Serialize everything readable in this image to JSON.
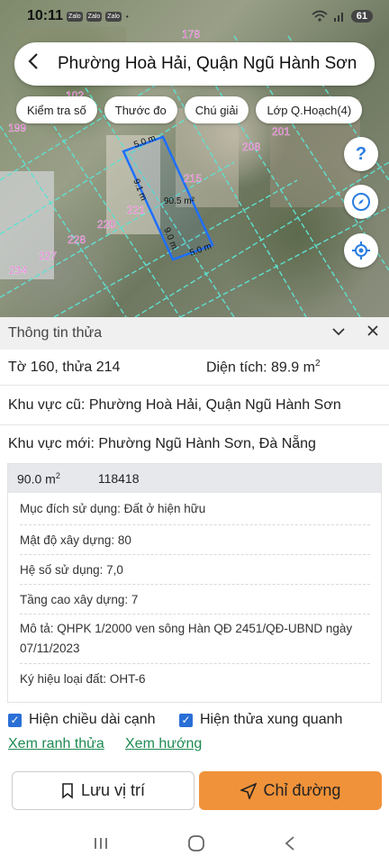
{
  "status_bar": {
    "time": "10:11",
    "apps": [
      "Zalo",
      "Zalo",
      "Zalo"
    ],
    "dot": "•",
    "wifi": "wifi-icon",
    "signal": "signal-icon",
    "battery": "61"
  },
  "header": {
    "title": "Phường Hoà Hải, Quận Ngũ Hành Sơn"
  },
  "chips": [
    "Kiểm tra số",
    "Thước đo",
    "Chú giải",
    "Lớp Q.Hoạch(4)"
  ],
  "map": {
    "parcel_labels": [
      "178",
      "102",
      "199",
      "208",
      "201",
      "215",
      "221",
      "220",
      "228",
      "227",
      "234"
    ],
    "dimension_labels": [
      "5.0 m",
      "9.1 m",
      "90.5 m²",
      "9.0 m",
      "5.0 m"
    ],
    "side_buttons": [
      "help-icon",
      "compass-icon",
      "locate-icon"
    ]
  },
  "panel": {
    "title": "Thông tin thửa",
    "sheet_parcel": "Tờ 160, thửa 214",
    "area_label": "Diện tích: 89.9 m",
    "area_sup": "2",
    "old_area": "Khu vực cũ: Phường Hoà Hải, Quận Ngũ Hành Sơn",
    "new_area": "Khu vực mới: Phường Ngũ Hành Sơn, Đà Nẵng"
  },
  "table": {
    "area": "90.0 m",
    "area_sup": "2",
    "code": "118418",
    "items": [
      "Mục đích sử dụng: Đất ở hiện hữu",
      "Mật độ xây dựng: 80",
      "Hệ số sử dụng: 7,0",
      "Tầng cao xây dựng: 7",
      "Mô tả: QHPK 1/2000 ven sông Hàn QĐ 2451/QĐ-UBND ngày 07/11/2023",
      "Ký hiệu loại đất: OHT-6"
    ]
  },
  "options": {
    "show_edge_length": "Hiện chiều dài cạnh",
    "show_neighbors": "Hiện thửa xung quanh"
  },
  "links": {
    "view_boundary": "Xem ranh thửa",
    "view_direction": "Xem hướng"
  },
  "buttons": {
    "save": "Lưu vị trí",
    "directions": "Chỉ đường"
  },
  "colors": {
    "accent": "#f0923a",
    "link": "#1f8a52",
    "checkbox": "#2a6fd6",
    "parcel_outline": "#1e6fff",
    "grid_line": "#5fe0d0",
    "map_label": "#e040c8"
  }
}
